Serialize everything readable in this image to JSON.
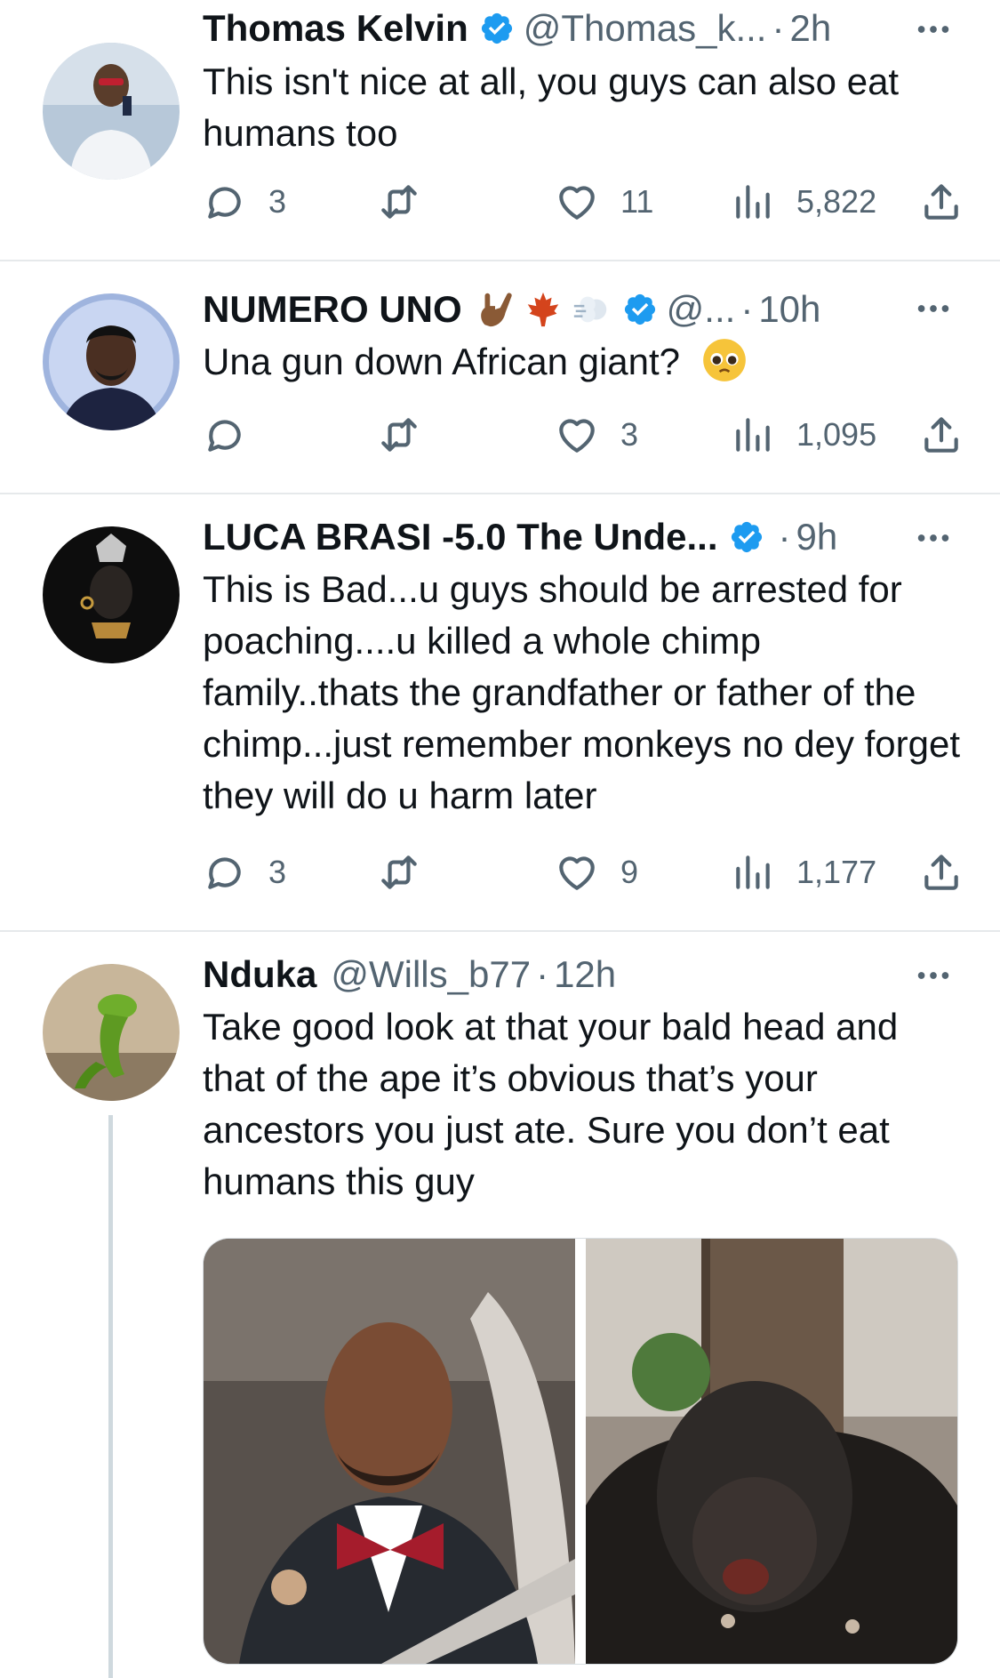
{
  "tweets": [
    {
      "name": "Thomas Kelvin",
      "handle": "@Thomas_k...",
      "time": "2h",
      "text": "This isn't nice at all, you guys can also eat humans too",
      "replies": "3",
      "retweets": "",
      "likes": "11",
      "views": "5,822"
    },
    {
      "name": "NUMERO UNO",
      "name_emojis": [
        "love-you-gesture-emoji",
        "maple-leaf-emoji",
        "dash-emoji"
      ],
      "handle": "@...",
      "time": "10h",
      "text": "Una gun down African giant?",
      "text_emoji": "pleading-face-emoji",
      "replies": "",
      "retweets": "",
      "likes": "3",
      "views": "1,095"
    },
    {
      "name": "LUCA BRASI -5.0 The Unde...",
      "handle": "",
      "time": "9h",
      "text": "This is Bad...u guys should be arrested for poaching....u killed a whole chimp family..thats the grandfather or father of the chimp...just remember monkeys no dey forget they will do u harm later",
      "replies": "3",
      "retweets": "",
      "likes": "9",
      "views": "1,177"
    },
    {
      "name": "Nduka",
      "handle": "@Wills_b77",
      "time": "12h",
      "text": "Take good look at that your bald head and that of the ape it’s obvious that’s your ancestors you just ate. Sure you don’t eat humans this guy",
      "media": [
        "photo-of-man-in-car",
        "photo-of-chimpanzee"
      ]
    }
  ],
  "separator": "·",
  "colors": {
    "verified_blue": "#1d9bf0",
    "secondary_text": "#536471",
    "primary_text": "#0f1419",
    "divider": "#e6e9eb"
  },
  "icons": {
    "reply": "reply-icon",
    "retweet": "retweet-icon",
    "like": "heart-icon",
    "views": "views-bar-chart-icon",
    "share": "share-icon",
    "more": "more-dots-icon",
    "verified": "verified-badge-icon"
  }
}
